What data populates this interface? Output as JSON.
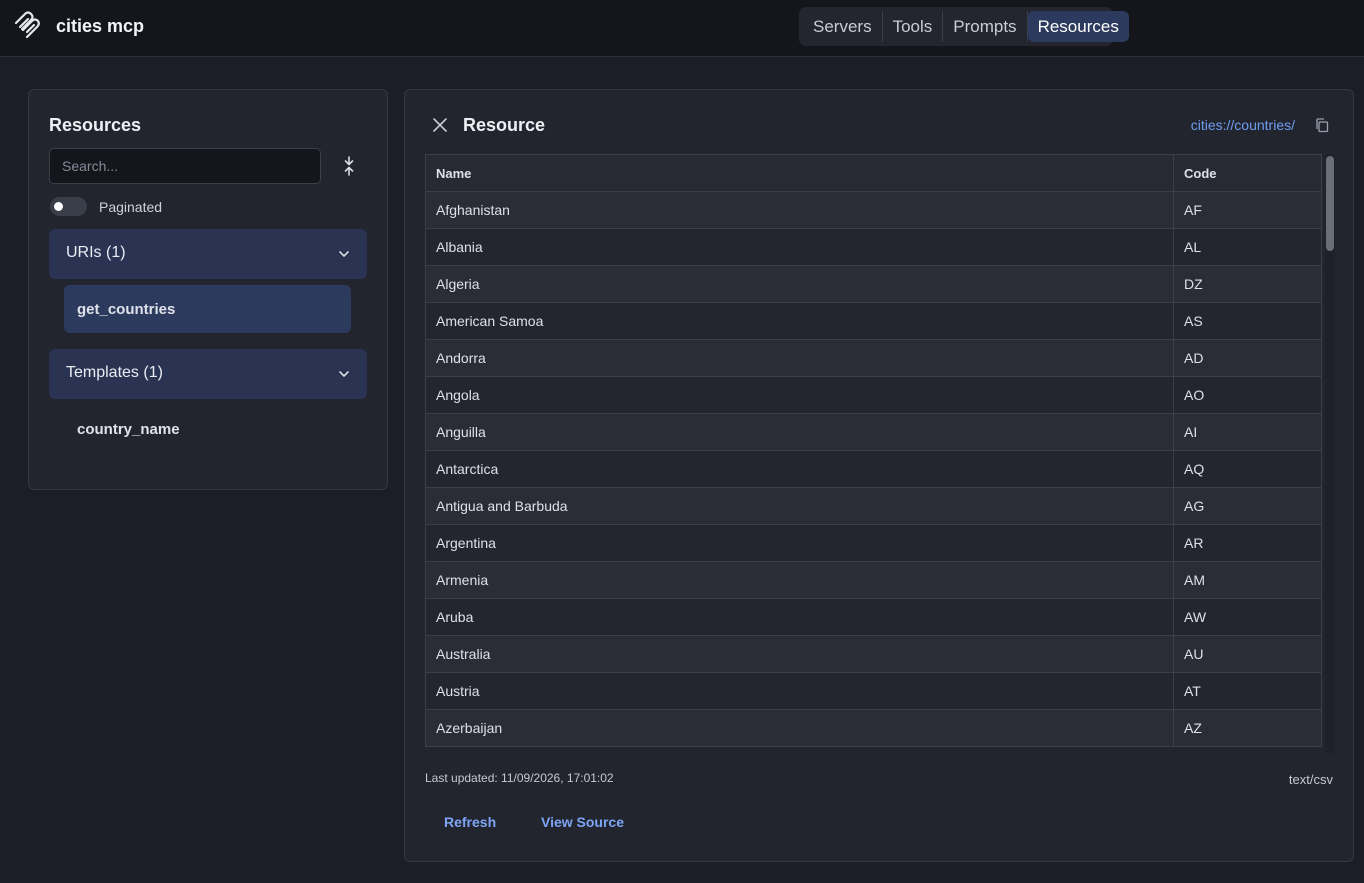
{
  "app": {
    "title": "cities mcp"
  },
  "nav": {
    "tabs": [
      "Servers",
      "Tools",
      "Prompts",
      "Resources"
    ],
    "active": "Resources"
  },
  "sidebar": {
    "title": "Resources",
    "search_placeholder": "Search...",
    "paginated_label": "Paginated",
    "uris": {
      "label": "URIs (1)",
      "items": [
        "get_countries"
      ]
    },
    "templates": {
      "label": "Templates (1)",
      "items": [
        "country_name"
      ]
    }
  },
  "resource": {
    "title": "Resource",
    "uri": "cities://countries/",
    "columns": [
      "Name",
      "Code"
    ],
    "rows": [
      [
        "Afghanistan",
        "AF"
      ],
      [
        "Albania",
        "AL"
      ],
      [
        "Algeria",
        "DZ"
      ],
      [
        "American Samoa",
        "AS"
      ],
      [
        "Andorra",
        "AD"
      ],
      [
        "Angola",
        "AO"
      ],
      [
        "Anguilla",
        "AI"
      ],
      [
        "Antarctica",
        "AQ"
      ],
      [
        "Antigua and Barbuda",
        "AG"
      ],
      [
        "Argentina",
        "AR"
      ],
      [
        "Armenia",
        "AM"
      ],
      [
        "Aruba",
        "AW"
      ],
      [
        "Australia",
        "AU"
      ],
      [
        "Austria",
        "AT"
      ],
      [
        "Azerbaijan",
        "AZ"
      ]
    ],
    "last_updated": "Last updated: 11/09/2026, 17:01:02",
    "mime_type": "text/csv",
    "refresh_label": "Refresh",
    "view_source_label": "View Source"
  },
  "colors": {
    "accent": "#6f9cf0",
    "active_tab": "#2c3a5e",
    "background": "#1b1e26"
  }
}
